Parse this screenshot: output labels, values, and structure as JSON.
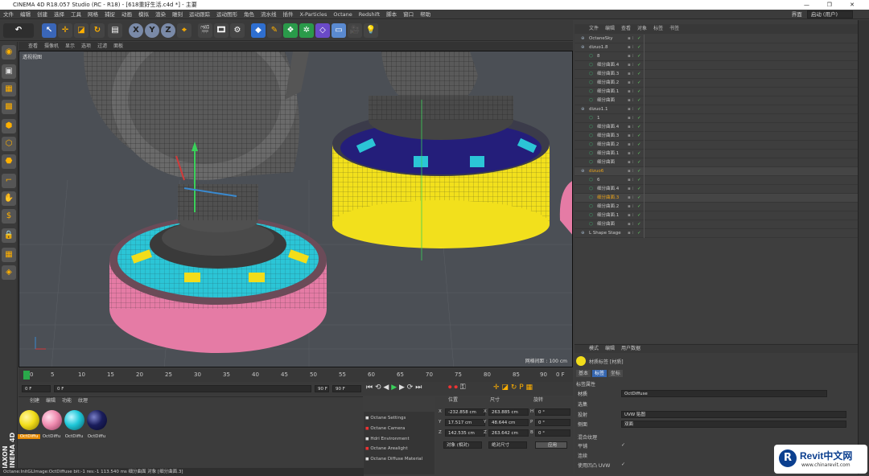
{
  "window": {
    "title": "CINEMA 4D R18.057 Studio (RC - R18) - [618重好生活.c4d *] - 主要",
    "buttons": [
      "—",
      "❐",
      "✕"
    ]
  },
  "menu": {
    "items": [
      "文件",
      "编辑",
      "创建",
      "选择",
      "工具",
      "网格",
      "捕捉",
      "动画",
      "模拟",
      "渲染",
      "雕刻",
      "运动跟踪",
      "运动图形",
      "角色",
      "流水线",
      "插件",
      "X-Particles",
      "Octane",
      "Redshift",
      "脚本",
      "窗口",
      "帮助"
    ],
    "layout_label": "界面",
    "layout_value": "启动 (用户)"
  },
  "viewport": {
    "menu": [
      "查看",
      "摄像机",
      "显示",
      "选项",
      "过滤",
      "面板"
    ],
    "label": "透视视图",
    "grid_text": "网格间距 : 100 cm"
  },
  "timeline": {
    "ticks": [
      "0",
      "5",
      "10",
      "15",
      "20",
      "25",
      "30",
      "35",
      "40",
      "45",
      "50",
      "55",
      "60",
      "65",
      "70",
      "75",
      "80",
      "85",
      "90"
    ],
    "end_label": "0 F"
  },
  "transport": {
    "current": "0 F",
    "start": "0 F",
    "end_a": "90 F",
    "end_b": "90 F"
  },
  "material_manager": {
    "menu": [
      "创建",
      "编辑",
      "功能",
      "纹理"
    ],
    "materials": [
      {
        "name": "OctDiffu",
        "color": "#f2dd1a"
      },
      {
        "name": "OctDiffu",
        "color": "#f08cb0"
      },
      {
        "name": "OctDiffu",
        "color": "#1ec7d8"
      },
      {
        "name": "OctDiffu",
        "color": "#1a1d5c"
      }
    ]
  },
  "octane_menu": [
    "Octane Settings",
    "Octane Camera",
    "Hdri Environment",
    "Octane Arealight",
    "Octane Diffuse Material"
  ],
  "coordinates": {
    "headers": [
      "位置",
      "尺寸",
      "旋转"
    ],
    "rows": [
      {
        "axis": "X",
        "pos": "-232.858 cm",
        "size_axis": "X",
        "size": "263.885 cm",
        "rot_axis": "H",
        "rot": "0 °"
      },
      {
        "axis": "Y",
        "pos": "17.517 cm",
        "size_axis": "Y",
        "size": "48.644 cm",
        "rot_axis": "P",
        "rot": "0 °"
      },
      {
        "axis": "Z",
        "pos": "142.535 cm",
        "size_axis": "Z",
        "size": "263.642 cm",
        "rot_axis": "B",
        "rot": "0 °"
      }
    ],
    "mode_select": "对象 (相对)",
    "size_select": "绝对尺寸",
    "apply": "应用"
  },
  "object_manager": {
    "menu": [
      "文件",
      "编辑",
      "查看",
      "对象",
      "标签",
      "书签"
    ],
    "objects": [
      {
        "name": "OctaneSky",
        "indent": 0,
        "highlight": false
      },
      {
        "name": "dizuo1.8",
        "indent": 0,
        "highlight": false
      },
      {
        "name": "8",
        "indent": 1,
        "highlight": false
      },
      {
        "name": "细分曲面.4",
        "indent": 1,
        "highlight": false
      },
      {
        "name": "细分曲面.3",
        "indent": 1,
        "highlight": false
      },
      {
        "name": "细分曲面.2",
        "indent": 1,
        "highlight": false
      },
      {
        "name": "细分曲面.1",
        "indent": 1,
        "highlight": false
      },
      {
        "name": "细分曲面",
        "indent": 1,
        "highlight": false
      },
      {
        "name": "dizuo1.1",
        "indent": 0,
        "highlight": false
      },
      {
        "name": "1",
        "indent": 1,
        "highlight": false
      },
      {
        "name": "细分曲面.4",
        "indent": 1,
        "highlight": false
      },
      {
        "name": "细分曲面.3",
        "indent": 1,
        "highlight": false
      },
      {
        "name": "细分曲面.2",
        "indent": 1,
        "highlight": false
      },
      {
        "name": "细分曲面.1",
        "indent": 1,
        "highlight": false
      },
      {
        "name": "细分曲面",
        "indent": 1,
        "highlight": false
      },
      {
        "name": "dizuo6",
        "indent": 0,
        "highlight": true
      },
      {
        "name": "6",
        "indent": 1,
        "highlight": false
      },
      {
        "name": "细分曲面.4",
        "indent": 1,
        "highlight": false
      },
      {
        "name": "细分曲面.3",
        "indent": 1,
        "highlight": true
      },
      {
        "name": "细分曲面.2",
        "indent": 1,
        "highlight": false
      },
      {
        "name": "细分曲面.1",
        "indent": 1,
        "highlight": false
      },
      {
        "name": "细分曲面",
        "indent": 1,
        "highlight": false
      },
      {
        "name": "L Shape Stage",
        "indent": 0,
        "highlight": false
      }
    ]
  },
  "attributes": {
    "menu": [
      "模式",
      "编辑",
      "用户数据"
    ],
    "title": "材质标签 [材质]",
    "tabs": [
      "基本",
      "标签",
      "坐标"
    ],
    "section": "标签属性",
    "fields": [
      {
        "label": "材质",
        "value": "OctDiffuse"
      },
      {
        "label": "选集",
        "value": ""
      },
      {
        "label": "投射",
        "value": "UVW 贴图"
      },
      {
        "label": "侧面",
        "value": "双面"
      },
      {
        "label": "混合纹理",
        "value": ""
      },
      {
        "label": "平铺",
        "value": "✓"
      },
      {
        "label": "连续",
        "value": ""
      },
      {
        "label": "使用凹凸 UVW",
        "value": "✓"
      }
    ]
  },
  "status_bar": "Octane:InitGLImage:OctDiffuse bit:-1 res:-1  113.540 ms   细分曲面 对象 [细分曲面.3]",
  "watermark": {
    "brand": "Revit中文网",
    "url": "www.chinarevit.com"
  },
  "side_brand": "MAXON CINEMA 4D"
}
